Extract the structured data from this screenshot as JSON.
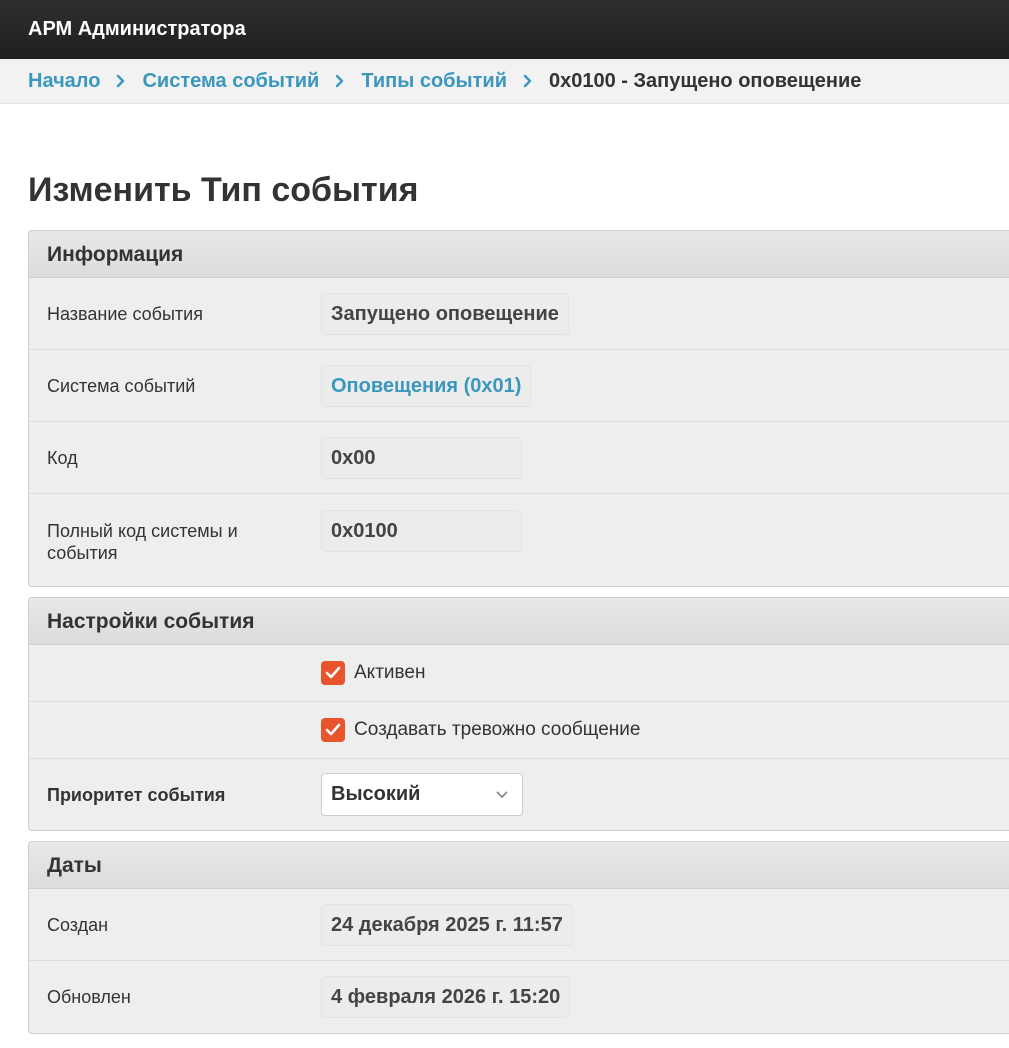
{
  "app": {
    "title": "АРМ Администратора"
  },
  "breadcrumb": {
    "items": [
      "Начало",
      "Система событий",
      "Типы событий"
    ],
    "current": "0x0100 - Запущено оповещение"
  },
  "page": {
    "title": "Изменить Тип события"
  },
  "info": {
    "heading": "Информация",
    "fields": [
      {
        "label": "Название события",
        "value": "Запущено оповещение"
      },
      {
        "label": "Система событий",
        "value": "Оповещения (0x01)"
      },
      {
        "label": "Код",
        "value": "0x00"
      },
      {
        "label": "Полный код системы и события",
        "value": "0x0100"
      }
    ]
  },
  "settings": {
    "heading": "Настройки события",
    "active_label": "Активен",
    "active_checked": true,
    "alarm_label": "Создавать тревожно сообщение",
    "alarm_checked": true,
    "priority_label": "Приоритет события",
    "priority_value": "Высокий"
  },
  "dates": {
    "heading": "Даты",
    "created_label": "Создан",
    "created_value": "24 декабря 2025 г. 11:57",
    "updated_label": "Обновлен",
    "updated_value": "4 февраля 2026 г. 15:20"
  },
  "colors": {
    "accent": "#3a97bd",
    "checkbox": "#e8542c",
    "topbar": "#222222"
  }
}
